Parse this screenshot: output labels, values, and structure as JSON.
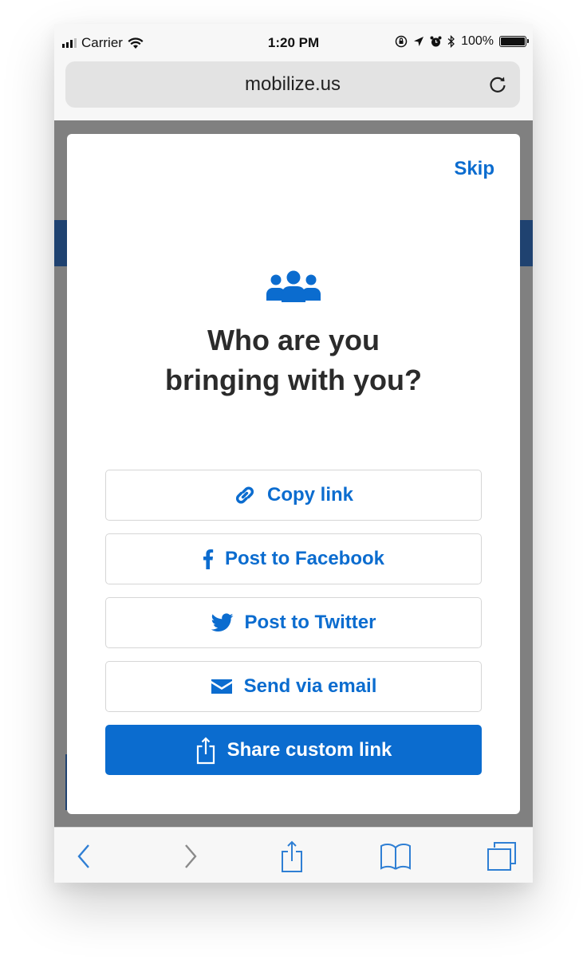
{
  "status_bar": {
    "carrier": "Carrier",
    "time": "1:20 PM",
    "battery": "100%",
    "battery_level": 1.0,
    "icons": [
      "signal-icon",
      "wifi-icon",
      "screen-lock-icon",
      "location-icon",
      "alarm-icon",
      "bluetooth-icon",
      "battery-icon"
    ]
  },
  "browser": {
    "url": "mobilize.us",
    "reload_icon": "reload-icon"
  },
  "modal": {
    "skip_label": "Skip",
    "icon": "people-group-icon",
    "title_line1": "Who are you",
    "title_line2": "bringing with you?",
    "buttons": [
      {
        "label": "Copy link",
        "icon": "link-icon"
      },
      {
        "label": "Post to Facebook",
        "icon": "facebook-icon"
      },
      {
        "label": "Post to Twitter",
        "icon": "twitter-icon"
      },
      {
        "label": "Send via email",
        "icon": "envelope-icon"
      },
      {
        "label": "Share custom link",
        "icon": "share-icon",
        "primary": true
      }
    ]
  },
  "toolbar": {
    "items": [
      "back-icon",
      "forward-icon",
      "share-icon",
      "bookmarks-icon",
      "tabs-icon"
    ]
  },
  "colors": {
    "accent": "#0b6ccf",
    "title_text": "#2b2b2b",
    "overlay": "#808080",
    "site_header": "#1f4270",
    "ios_blue": "#2f7fd4"
  }
}
